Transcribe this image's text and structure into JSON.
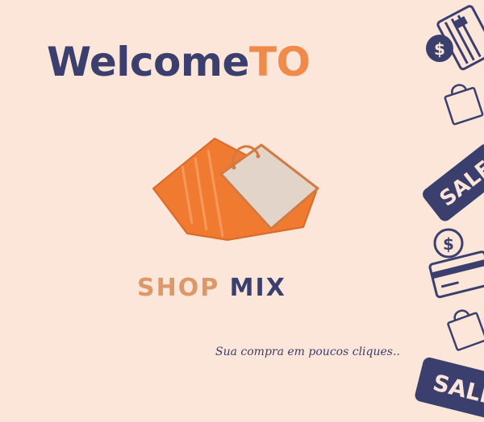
{
  "headline": {
    "welcome": "Welcome",
    "to": "TO"
  },
  "brand": {
    "shop": "SHOP",
    "mix": "MIX"
  },
  "tagline": "Sua compra em poucos cliques..",
  "decor": {
    "sale_label": "SALE",
    "dollar_symbol": "$"
  },
  "colors": {
    "background": "#fbe6d9",
    "navy": "#3b3f6e",
    "orange": "#f08a4b",
    "tan": "#dc9869"
  },
  "icons": [
    "shopping-bags-logo-icon",
    "dollar-coin-icon",
    "credit-card-icon",
    "shopping-bag-icon",
    "sale-tag-icon"
  ]
}
